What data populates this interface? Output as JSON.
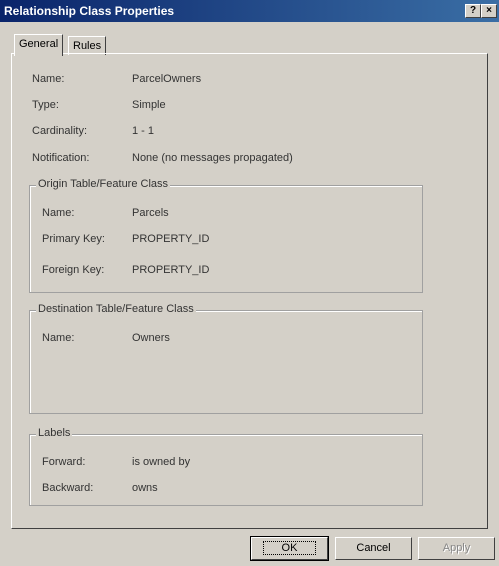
{
  "window": {
    "title": "Relationship Class Properties",
    "help_glyph": "?",
    "close_glyph": "×"
  },
  "tabs": [
    {
      "label": "General"
    },
    {
      "label": "Rules"
    }
  ],
  "general": {
    "name_label": "Name:",
    "name_value": "ParcelOwners",
    "type_label": "Type:",
    "type_value": "Simple",
    "cardinality_label": "Cardinality:",
    "cardinality_value": "1 - 1",
    "notification_label": "Notification:",
    "notification_value": "None (no messages propagated)"
  },
  "origin": {
    "legend": "Origin Table/Feature Class",
    "name_label": "Name:",
    "name_value": "Parcels",
    "primary_key_label": "Primary Key:",
    "primary_key_value": "PROPERTY_ID",
    "foreign_key_label": "Foreign Key:",
    "foreign_key_value": "PROPERTY_ID"
  },
  "destination": {
    "legend": "Destination Table/Feature Class",
    "name_label": "Name:",
    "name_value": "Owners"
  },
  "labels": {
    "legend": "Labels",
    "forward_label": "Forward:",
    "forward_value": "is owned by",
    "backward_label": "Backward:",
    "backward_value": "owns"
  },
  "buttons": {
    "ok": "OK",
    "cancel": "Cancel",
    "apply": "Apply"
  }
}
